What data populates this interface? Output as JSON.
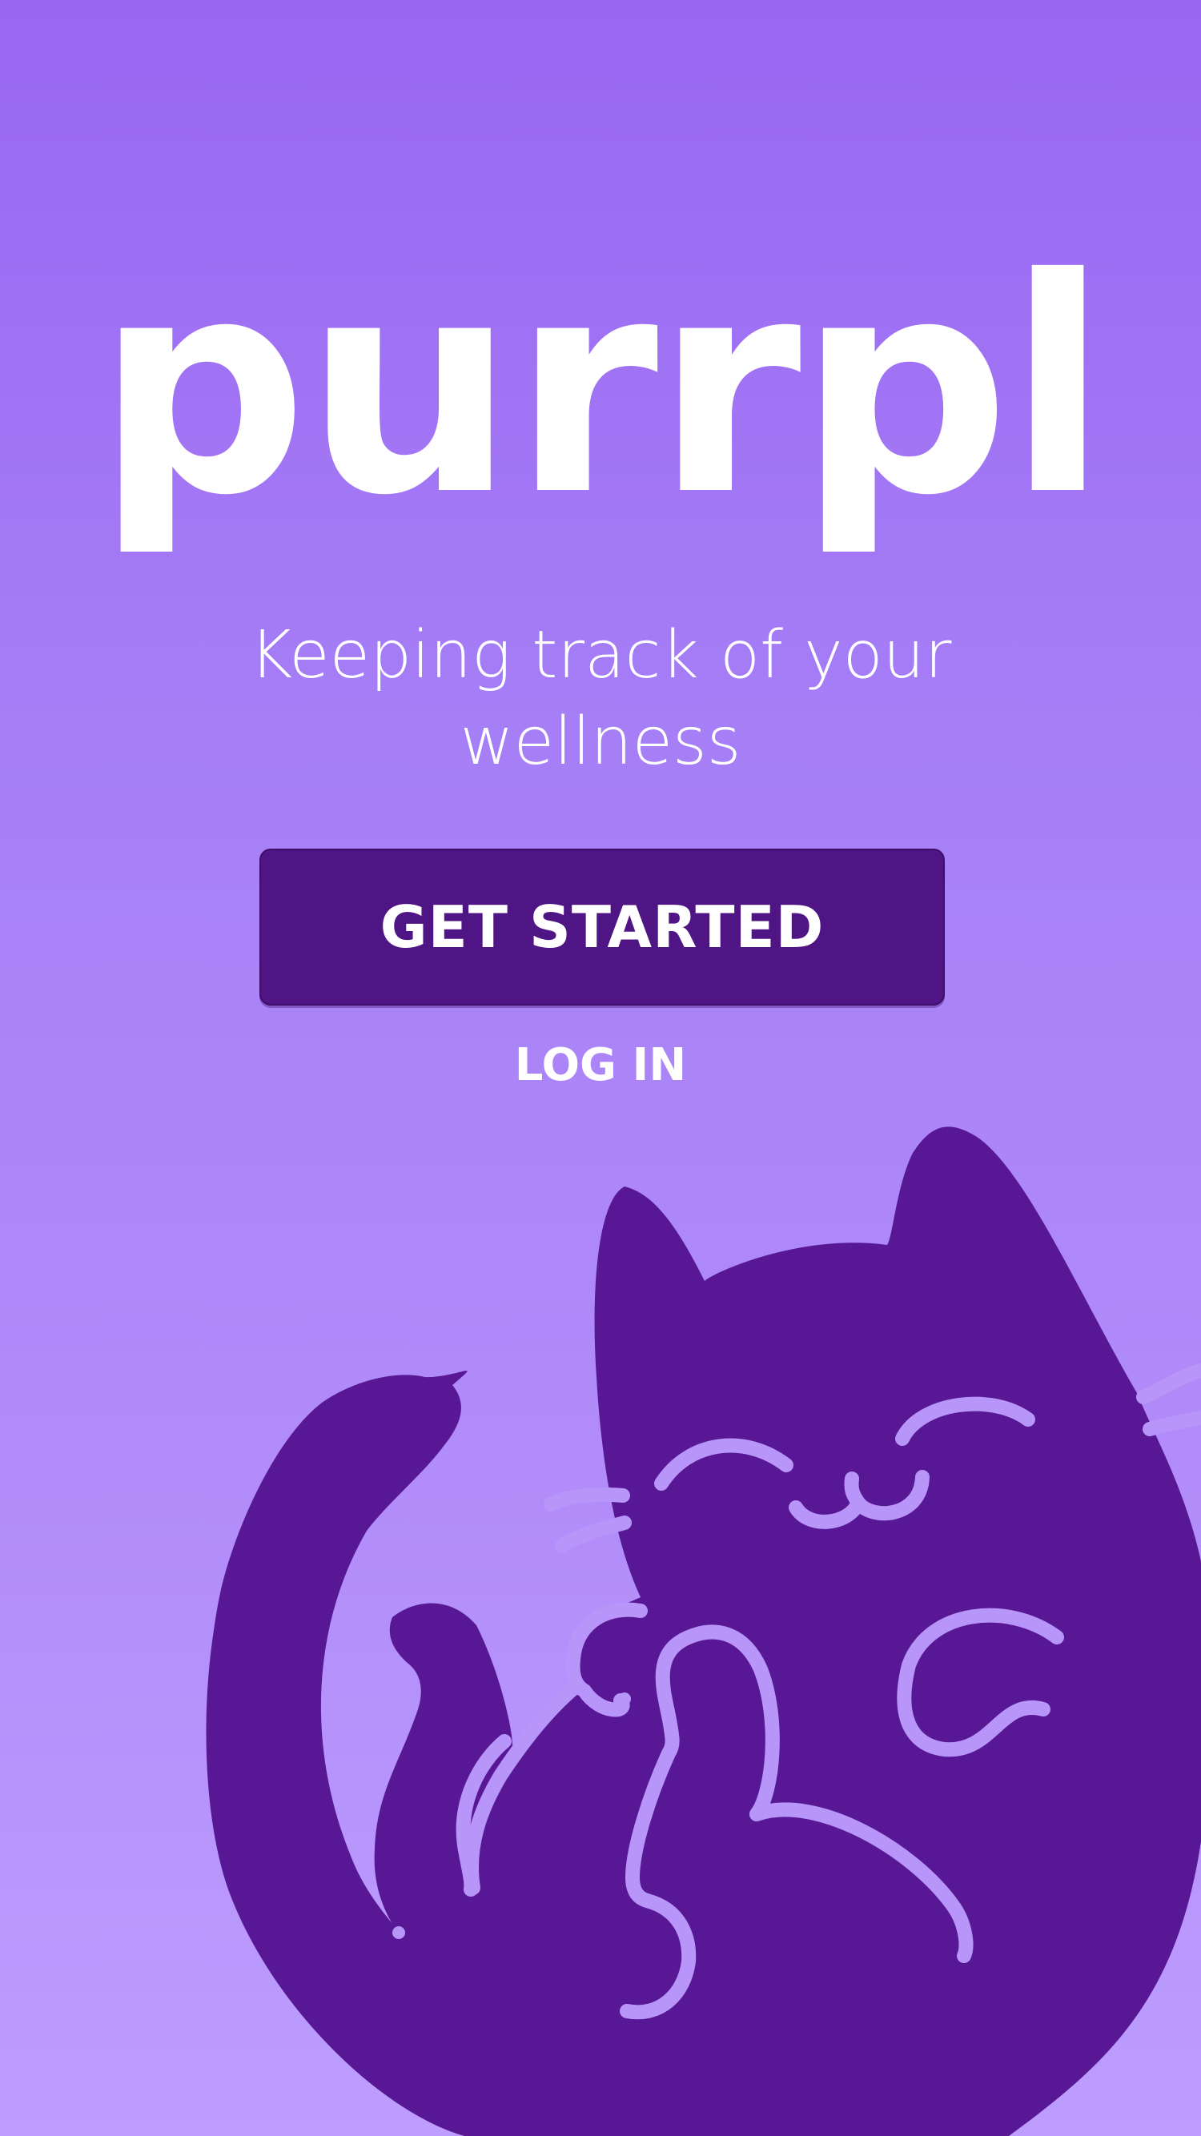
{
  "app": {
    "logo": "purrpl",
    "tagline": "Keeping track of your wellness"
  },
  "actions": {
    "get_started_label": "GET STARTED",
    "login_label": "LOG IN"
  },
  "illustration": {
    "name": "cat-illustration"
  },
  "colors": {
    "background_top": "#9966f2",
    "background_bottom": "#bd9dfe",
    "button": "#4f1585",
    "cat_body": "#581895",
    "cat_lines": "#b895f8"
  }
}
